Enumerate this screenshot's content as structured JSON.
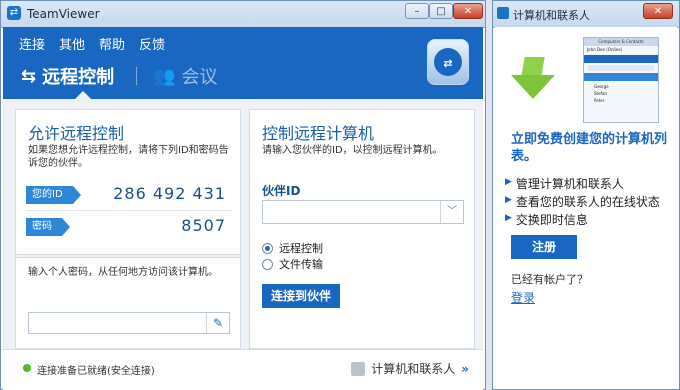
{
  "main_window": {
    "title": "TeamViewer",
    "controls": {
      "minimize": "–",
      "maximize": "□",
      "close": "✕"
    },
    "menu": [
      "连接",
      "其他",
      "帮助",
      "反馈"
    ],
    "modes": {
      "active": "远程控制",
      "inactive": "会议"
    },
    "allow_panel": {
      "title": "允许远程控制",
      "description": "如果您想允许远程控制，请将下列ID和密码告诉您的伙伴。",
      "id_label": "您的ID",
      "id_value": "286 492 431",
      "password_label": "密码",
      "password_value": "8507"
    },
    "personal_password": {
      "hint": "输入个人密码，从任何地方访问该计算机。"
    },
    "control_panel": {
      "title": "控制远程计算机",
      "description": "请输入您伙伴的ID，以控制远程计算机。",
      "partner_id_label": "伙伴ID",
      "partner_id_value": "",
      "options": [
        {
          "label": "远程控制",
          "selected": true
        },
        {
          "label": "文件传输",
          "selected": false
        }
      ],
      "connect_button": "连接到伙伴"
    },
    "status": {
      "text": "连接准备已就绪(安全连接)",
      "color": "#4dbb2c"
    },
    "contacts_link": "计算机和联系人"
  },
  "side_window": {
    "title": "计算机和联系人",
    "controls": {
      "close": "✕"
    },
    "headline": "立即免费创建您的计算机列表。",
    "bullets": [
      "管理计算机和联系人",
      "查看您的联系人的在线状态",
      "交换即时信息"
    ],
    "signup_button": "注册",
    "have_account": "已经有帐户了？",
    "login_link": "登录",
    "preview": {
      "header": "Computers & Contacts",
      "user": "John Doe (Online)",
      "entries": [
        "George",
        "Stefan",
        "Peter"
      ]
    }
  },
  "colors": {
    "accent": "#1a67c1",
    "status_online": "#4dbb2c"
  }
}
